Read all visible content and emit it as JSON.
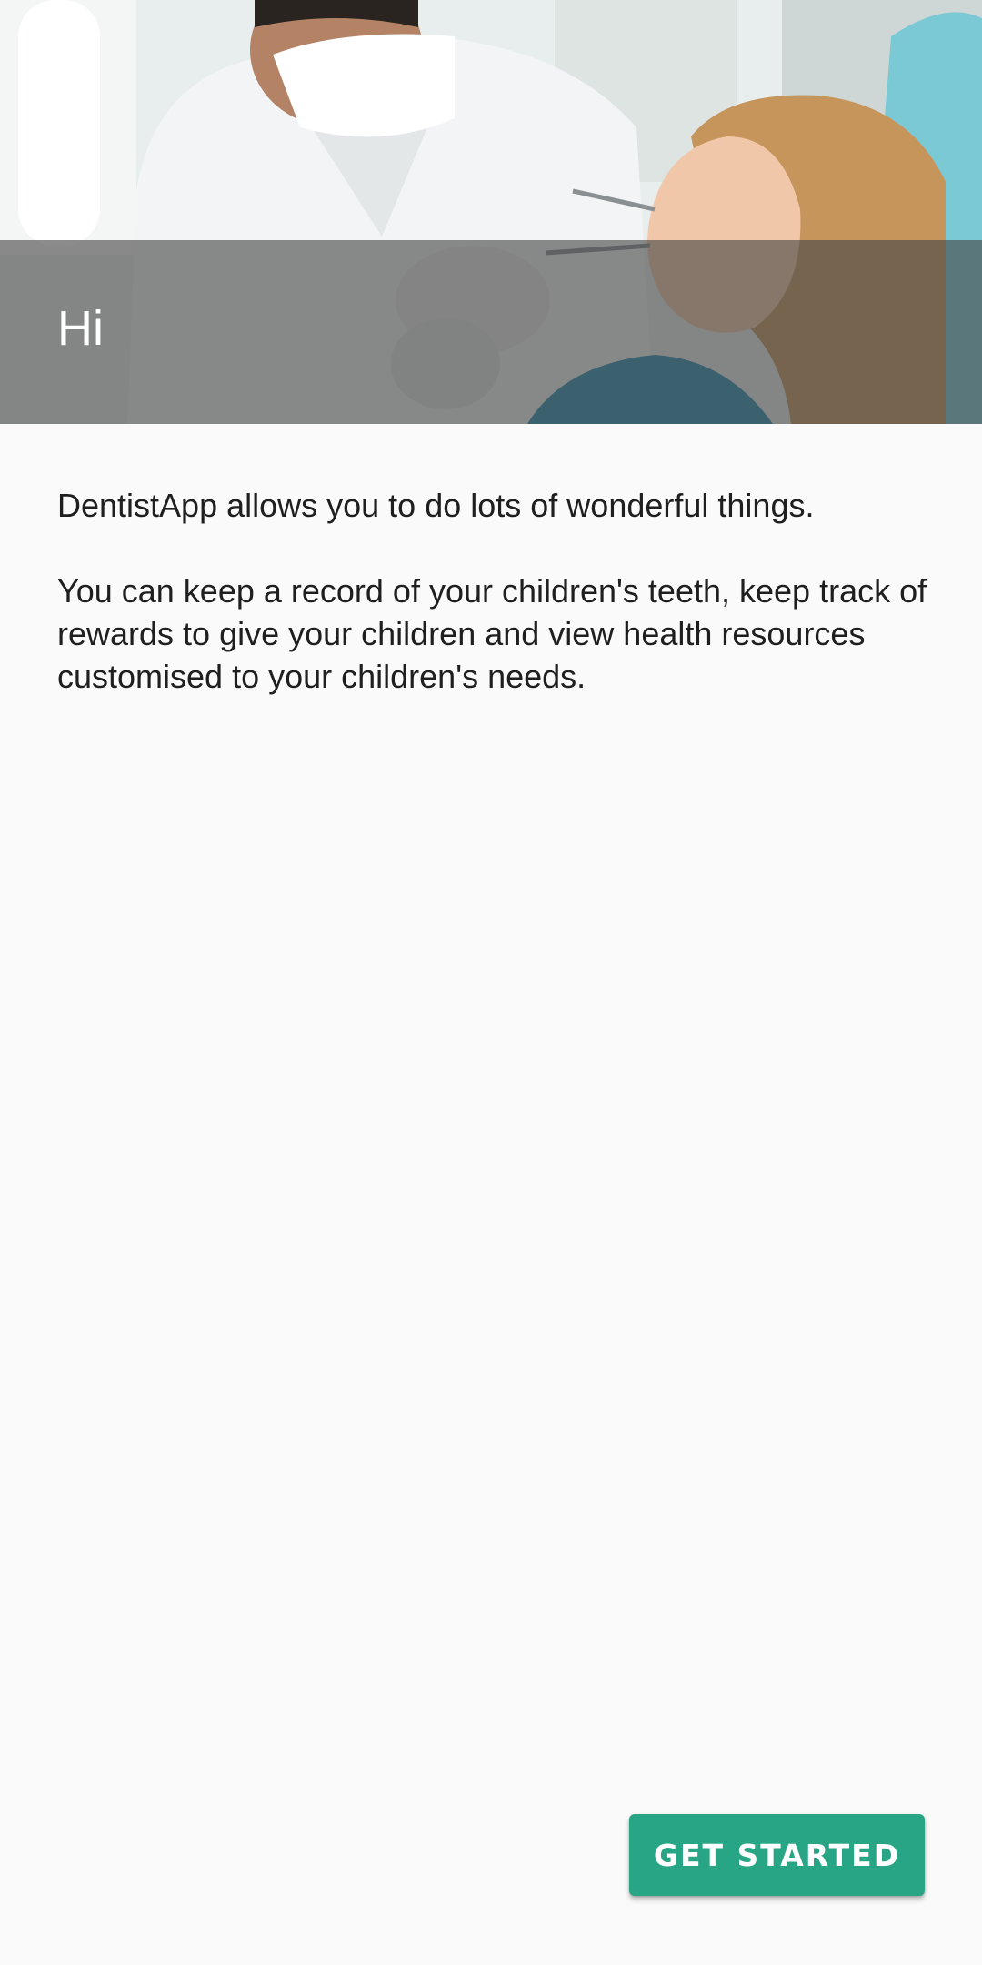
{
  "header": {
    "title": "Hi",
    "image": "dentist-examining-child-photo"
  },
  "intro": {
    "paragraph_1": "DentistApp allows you to do lots of wonderful things.",
    "paragraph_2": "You can keep a record of your children's teeth, keep track of rewards to give your children and view health resources customised to your children's needs."
  },
  "actions": {
    "get_started_label": "GET STARTED"
  },
  "colors": {
    "accent": "#27a585",
    "background": "#fafafa",
    "overlay": "#464646"
  }
}
